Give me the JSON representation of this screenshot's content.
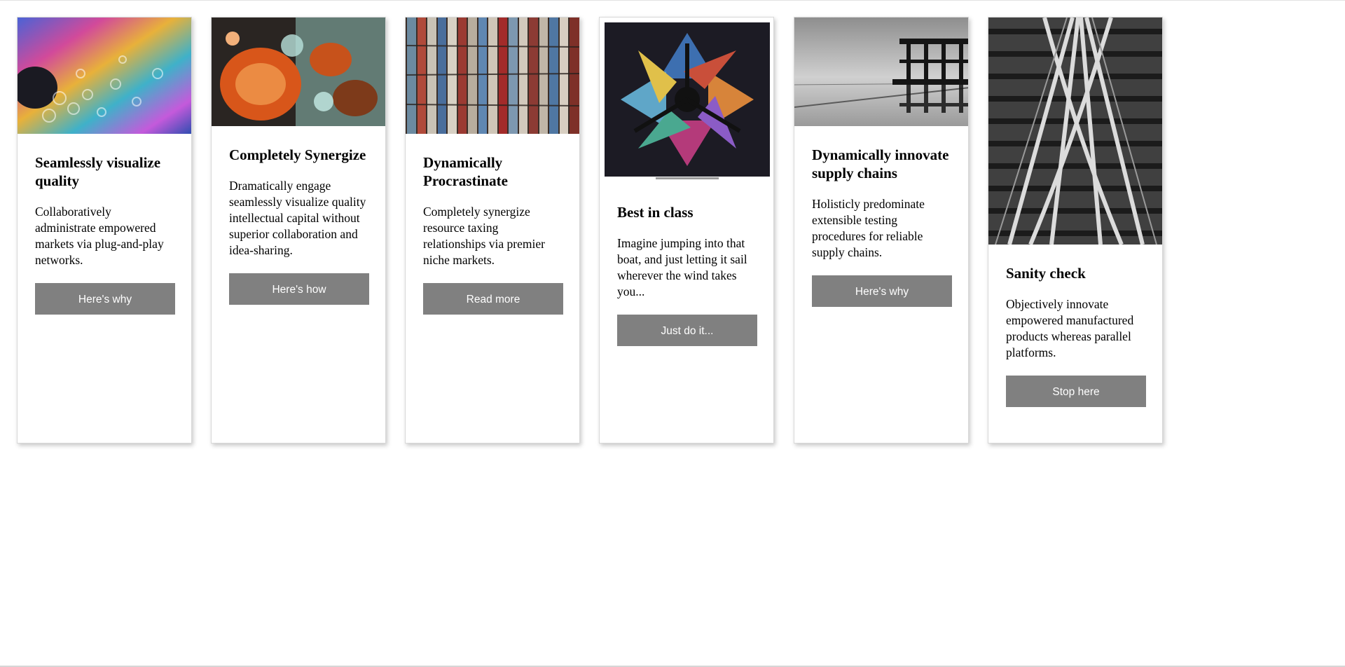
{
  "cards": [
    {
      "title": "Seamlessly visualize quality",
      "text": "Collaboratively administrate empowered markets via plug-and-play networks.",
      "button": "Here's why"
    },
    {
      "title": "Completely Synergize",
      "text": "Dramatically engage seamlessly visualize quality intellectual capital without superior collaboration and idea-sharing.",
      "button": "Here's how"
    },
    {
      "title": "Dynamically Procrastinate",
      "text": "Completely synergize resource taxing relationships via premier niche markets.",
      "button": "Read more"
    },
    {
      "title": "Best in class",
      "text": "Imagine jumping into that boat, and just letting it sail wherever the wind takes you...",
      "button": "Just do it..."
    },
    {
      "title": "Dynamically innovate supply chains",
      "text": "Holisticly predominate extensible testing procedures for reliable supply chains.",
      "button": "Here's why"
    },
    {
      "title": "Sanity check",
      "text": "Objectively innovate empowered manufactured products whereas parallel platforms.",
      "button": "Stop here"
    }
  ],
  "images": [
    "oil-slick-photo",
    "oil-bubbles-photo",
    "stacked-bricks-photo",
    "kaleidoscope-photo",
    "pier-reflection-photo",
    "railway-tracks-photo"
  ]
}
